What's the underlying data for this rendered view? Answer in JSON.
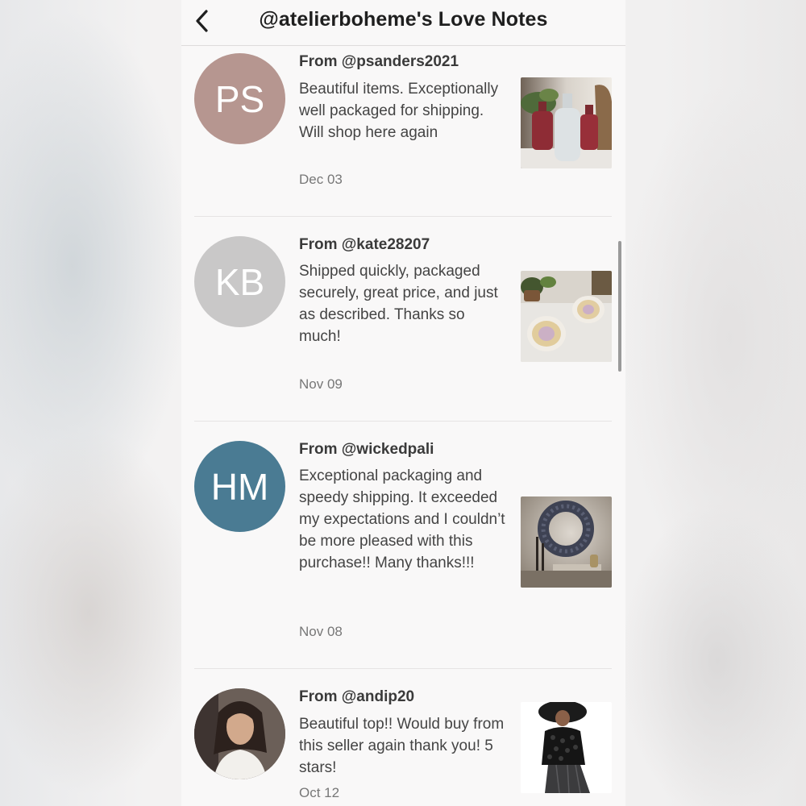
{
  "header": {
    "title": "@atelierboheme's Love Notes",
    "back_icon": "chevron-left-icon"
  },
  "notes": [
    {
      "initials": "PS",
      "avatar_color": "#b69690",
      "from": "From @psanders2021",
      "message": "Beautiful items. Exceptionally well packaged for shipping. Will shop here again",
      "date": "Dec 03",
      "thumbnail": "bottles-photo"
    },
    {
      "initials": "KB",
      "avatar_color": "#c9c8c8",
      "from": "From @kate28207",
      "message": "Shipped quickly, packaged securely, great price, and just as described. Thanks so much!",
      "date": "Nov 09",
      "thumbnail": "glass-dishes-photo"
    },
    {
      "initials": "HM",
      "avatar_color": "#4a7b93",
      "from": "From @wickedpali",
      "message": "Exceptional packaging and speedy shipping. It exceeded my expectations and I couldn’t be more pleased with this purchase!! Many thanks!!!",
      "date": "Nov 08",
      "thumbnail": "wreath-photo"
    },
    {
      "initials": "",
      "avatar_color": "#5a4e48",
      "from": "From @andip20",
      "message": "Beautiful top!! Would buy from this seller again thank you! 5 stars!",
      "date": "Oct 12",
      "thumbnail": "black-top-photo"
    }
  ]
}
